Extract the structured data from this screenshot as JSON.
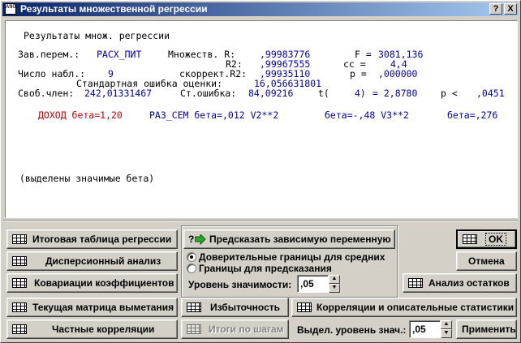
{
  "window": {
    "title": "Результаты множественной регрессии",
    "help_button": "?",
    "close_button": "X",
    "app_icon_text": "ANOVA"
  },
  "output": {
    "heading": "Результаты множ. регрессии",
    "line1": {
      "dep_label": "Зав.перем.:",
      "dep_value": "РАСХ_ПИТ",
      "mult_r_label": "Множеств. R:",
      "mult_r_value": ",99983776",
      "f_label": "F =",
      "f_value": "3081,136"
    },
    "line2": {
      "r2_label": "R2:",
      "r2_value": ",99967555",
      "cc_label": "сс =",
      "cc_value": "4,4"
    },
    "line3": {
      "n_label": "Число набл.:",
      "n_value": "9",
      "adj_label": "скоррект.R2:",
      "adj_value": ",99935110",
      "p_label": "p =",
      "p_value": ",000000"
    },
    "line4": {
      "se_label": "Стандартная ошибка оценки:",
      "se_value": "16,056631801"
    },
    "line5": {
      "int_label": "Своб.член:",
      "int_value": "242,01331467",
      "sterr_label": "Ст.ошибка:",
      "sterr_value": "84,09216",
      "t_label": "t(",
      "t_df": "4)",
      "t_value": "= 2,8780",
      "plt_label": "p <",
      "plt_value": ",0451"
    },
    "betas": [
      {
        "text": "ДОХОД бета=1,20",
        "significant": true
      },
      {
        "text": "РАЗ_СЕМ бета=,012 V2**2",
        "significant": false
      },
      {
        "text": "бета=-,48 V3**2",
        "significant": false
      },
      {
        "text": "бета=,276",
        "significant": false
      }
    ],
    "note": "(выделены значимые бета)"
  },
  "buttons": {
    "summary": "Итоговая таблица регрессии",
    "anova": "Дисперсионный анализ",
    "covariances": "Ковариации коэффициентов",
    "sweep": "Текущая матрица выметания",
    "partial": "Частные корреляции",
    "predict": "Предсказать зависимую переменную",
    "redundancy": "Избыточность",
    "stepwise": "Итоги по шагам",
    "correlations": "Корреляции и описательные статистики",
    "ok": "OK",
    "cancel": "Отмена",
    "residuals": "Анализ остатков",
    "apply": "Применить"
  },
  "prediction": {
    "options": [
      "Доверительные границы для средних",
      "Границы для предсказания"
    ],
    "selected": 0,
    "alpha_label": "Уровень значимости:",
    "alpha_value": ",05"
  },
  "highlight": {
    "label": "Выдел. уровень знач.:",
    "value": ",05"
  },
  "colors": {
    "title_bar": "#0a246a",
    "significant": "#c00000",
    "nonsignificant": "#0000a8"
  }
}
